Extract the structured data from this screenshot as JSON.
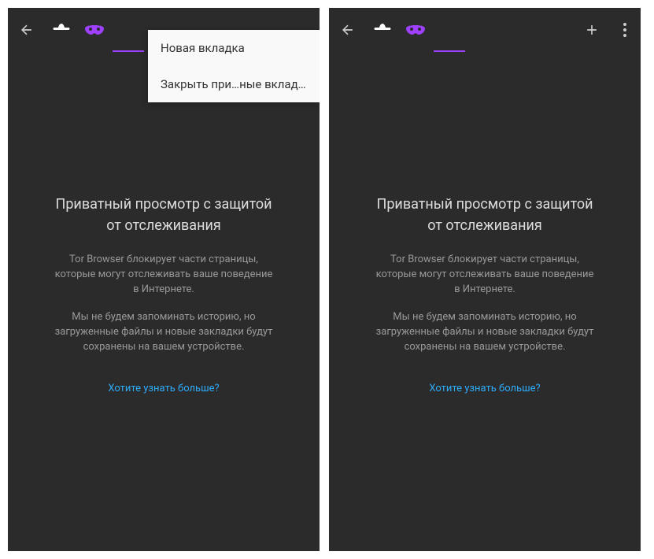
{
  "menu": {
    "item1": "Новая вкладка",
    "item2": "Закрыть при…ные вкладки"
  },
  "content": {
    "title": "Приватный просмотр с защитой от отслеживания",
    "desc1": "Tor Browser блокирует части страницы, которые могут отслеживать ваше поведение в Интернете.",
    "desc2": "Мы не будем запоминать историю, но загруженные файлы и новые закладки будут сохранены на вашем устройстве.",
    "link": "Хотите узнать больше?"
  }
}
